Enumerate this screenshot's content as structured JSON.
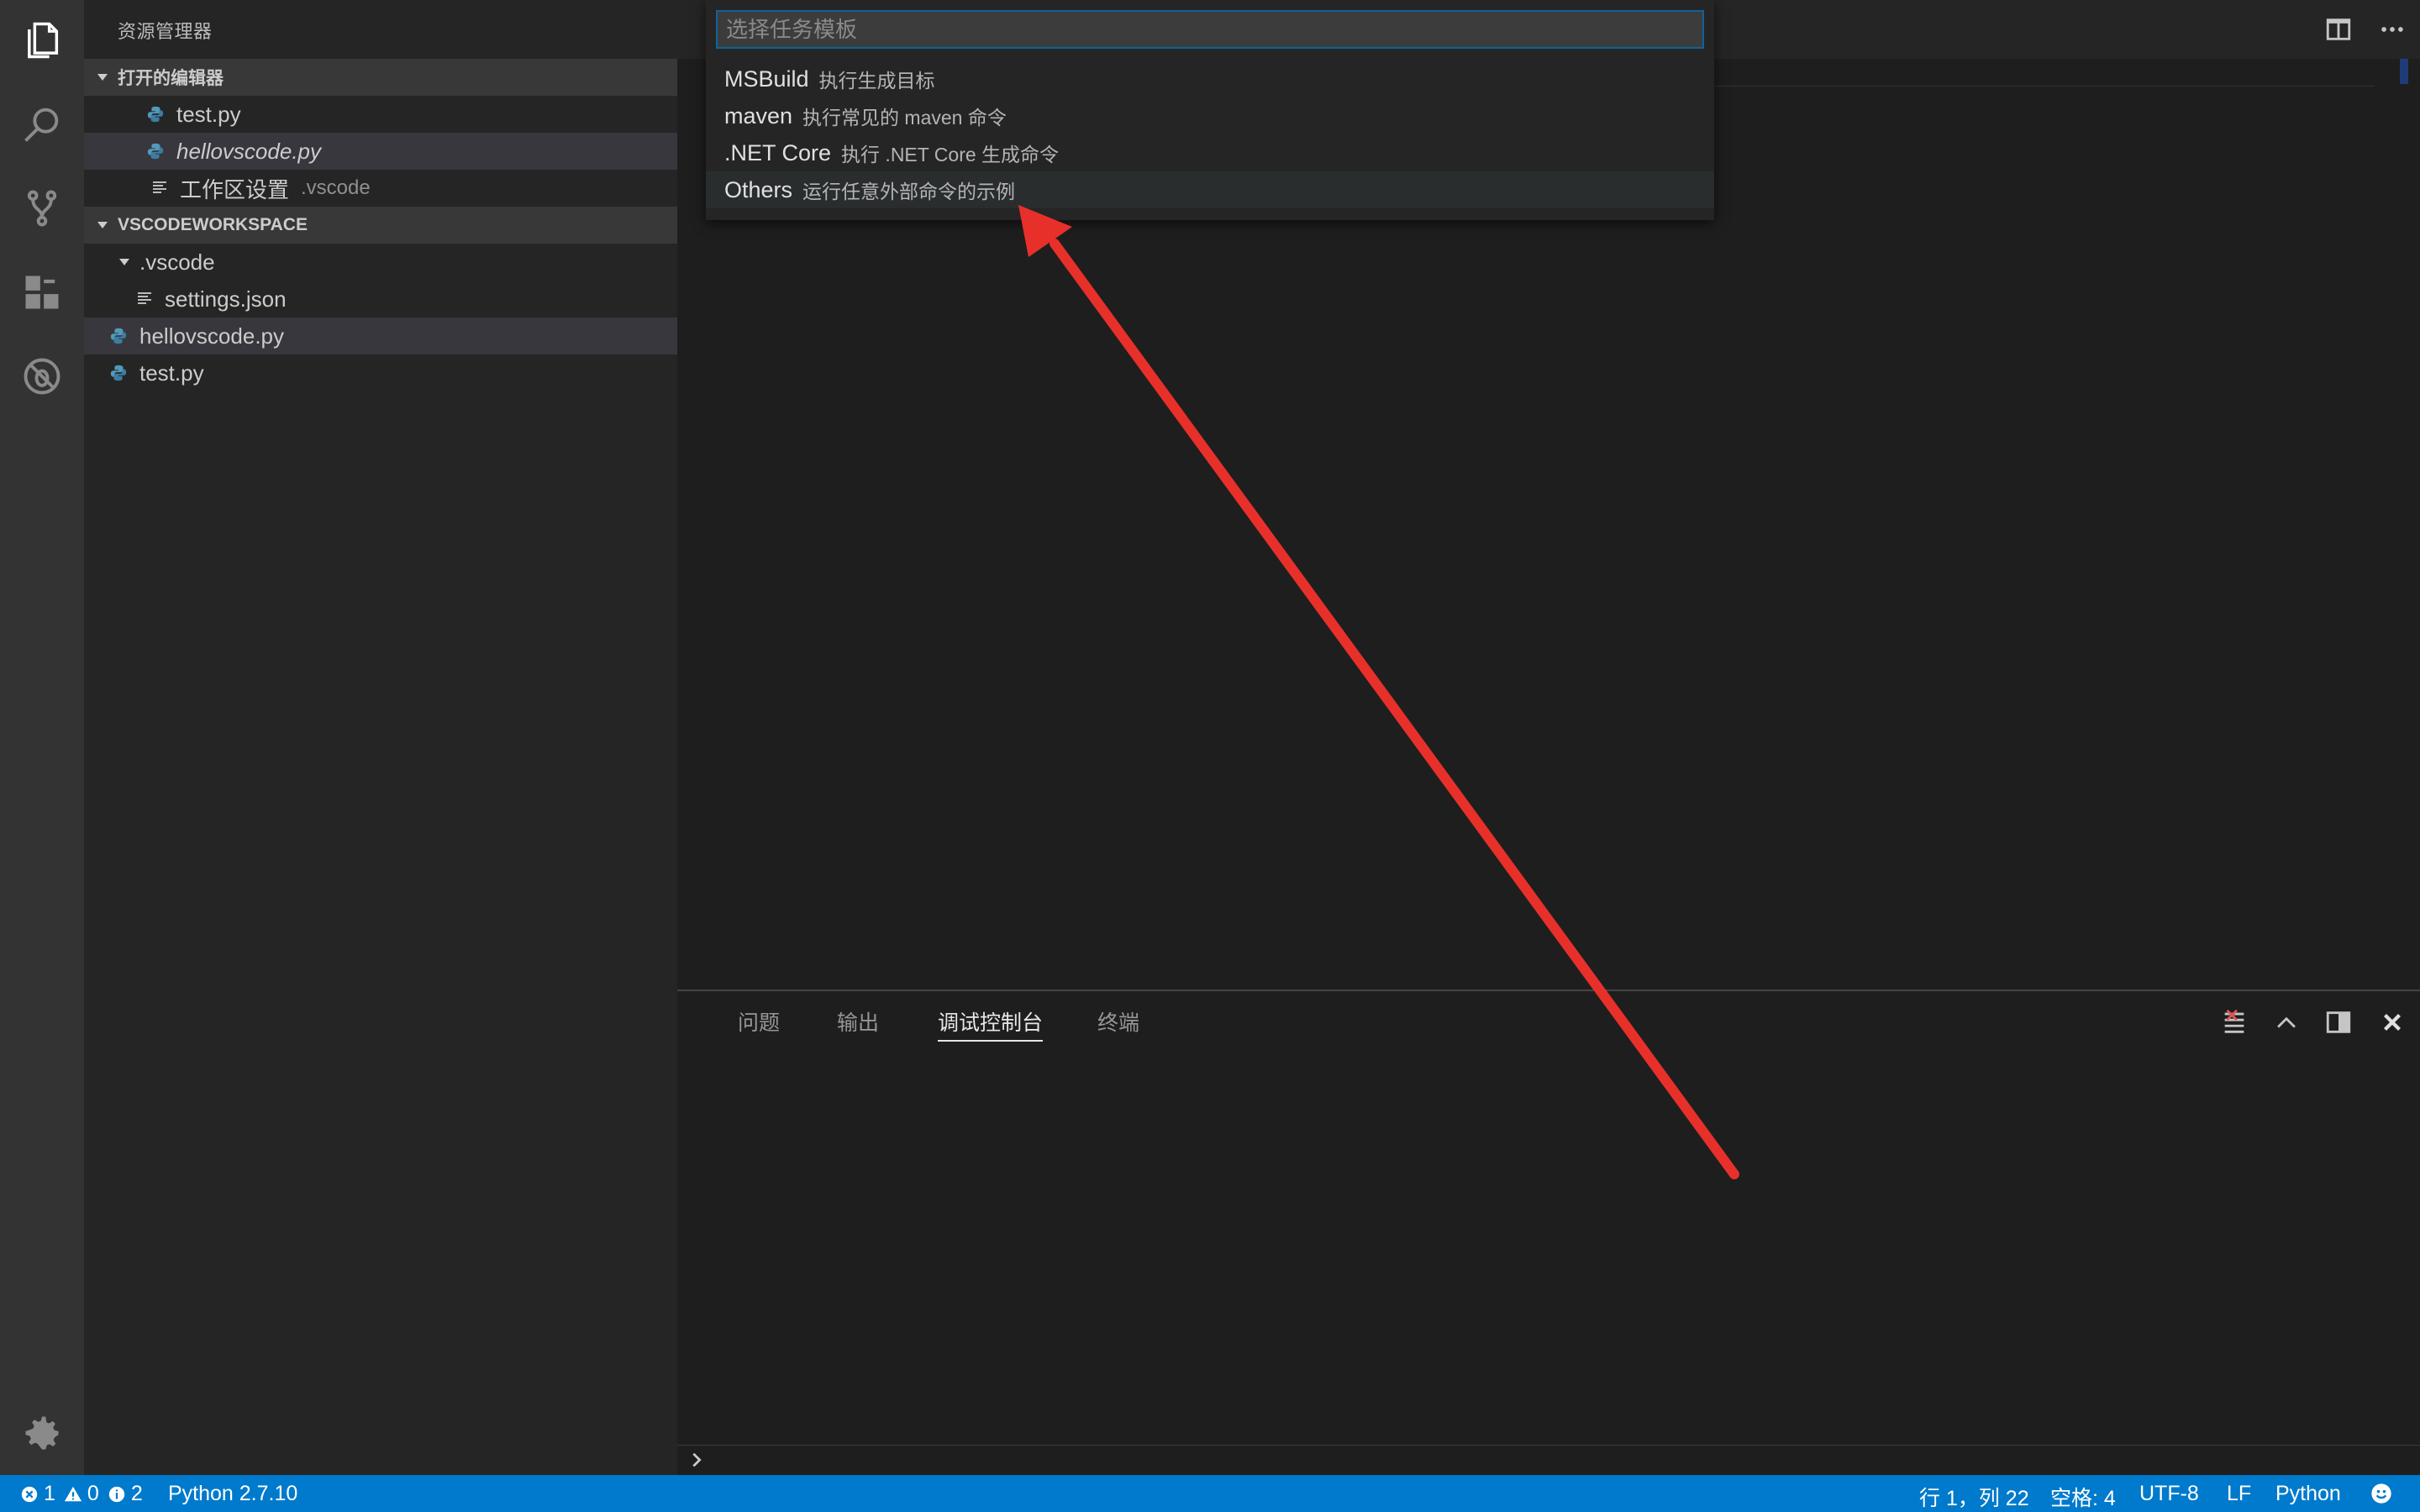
{
  "sidebar": {
    "title": "资源管理器",
    "open_editors": {
      "header": "打开的编辑器",
      "items": [
        {
          "label": "test.py"
        },
        {
          "label": "hellovscode.py"
        },
        {
          "label": "工作区设置",
          "detail": ".vscode"
        }
      ]
    },
    "workspace": {
      "header": "VSCODEWORKSPACE",
      "items": [
        {
          "label": ".vscode"
        },
        {
          "label": "settings.json"
        },
        {
          "label": "hellovscode.py"
        },
        {
          "label": "test.py"
        }
      ]
    }
  },
  "quickpick": {
    "placeholder": "选择任务模板",
    "items": [
      {
        "label": "MSBuild",
        "description": "执行生成目标"
      },
      {
        "label": "maven",
        "description": "执行常见的 maven 命令"
      },
      {
        "label": ".NET Core",
        "description": "执行 .NET Core 生成命令"
      },
      {
        "label": "Others",
        "description": "运行任意外部命令的示例"
      }
    ]
  },
  "panel": {
    "tabs": [
      "问题",
      "输出",
      "调试控制台",
      "终端"
    ],
    "active_tab": "调试控制台"
  },
  "statusbar": {
    "errors": "1",
    "warnings": "0",
    "infos": "2",
    "interpreter": "Python 2.7.10",
    "position": "行 1，列 22",
    "spaces": "空格: 4",
    "encoding": "UTF-8",
    "eol": "LF",
    "language": "Python"
  },
  "colors": {
    "accent": "#007acc",
    "annotation_arrow": "#e8302a"
  },
  "icons": [
    "files-icon",
    "search-icon",
    "source-control-icon",
    "extensions-icon",
    "debug-icon",
    "gear-icon",
    "split-editor-icon",
    "more-icon",
    "clear-console-icon",
    "maximize-panel-icon",
    "toggle-panel-position-icon",
    "close-icon",
    "error-icon",
    "warning-icon",
    "info-icon",
    "smiley-icon"
  ]
}
